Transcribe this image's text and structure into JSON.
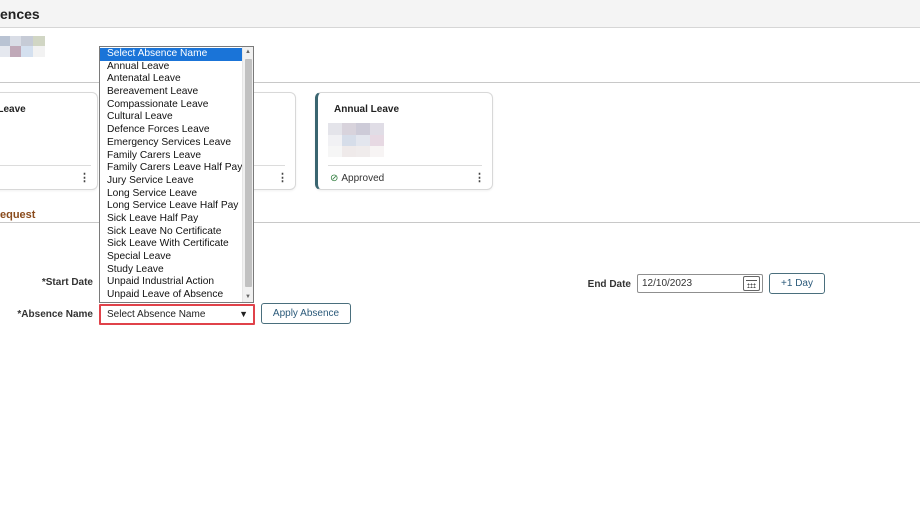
{
  "header": {
    "title": "ences"
  },
  "cards": [
    {
      "title": "e Leave",
      "kebab": "⋮"
    },
    {
      "title": "",
      "kebab": "⋮"
    },
    {
      "title": "Annual Leave",
      "status": "Approved",
      "kebab": "⋮"
    }
  ],
  "section": {
    "label": "equest"
  },
  "form": {
    "start_label": "*Start Date",
    "end_label": "End Date",
    "end_date_value": "12/10/2023",
    "plus_day_label": "+1 Day",
    "absence_label": "*Absence Name",
    "absence_selected": "Select Absence Name",
    "apply_label": "Apply Absence"
  },
  "dropdown": {
    "options": [
      "Select Absence Name",
      "Annual Leave",
      "Antenatal Leave",
      "Bereavement Leave",
      "Compassionate Leave",
      "Cultural Leave",
      "Defence Forces Leave",
      "Emergency Services Leave",
      "Family Carers Leave",
      "Family Carers Leave Half Pay",
      "Jury Service Leave",
      "Long Service Leave",
      "Long Service Leave Half Pay",
      "Sick Leave Half Pay",
      "Sick Leave No Certificate",
      "Sick Leave With Certificate",
      "Special Leave",
      "Study Leave",
      "Unpaid Industrial Action",
      "Unpaid Leave of Absence"
    ]
  },
  "colors": {
    "accent": "#1a74d8",
    "highlight_border": "#e0424a",
    "section_label": "#8a4b1c"
  },
  "icons": {
    "calendar": "calendar-icon",
    "approved": "check-circle-icon",
    "select_arrow": "chevron-down-icon"
  }
}
